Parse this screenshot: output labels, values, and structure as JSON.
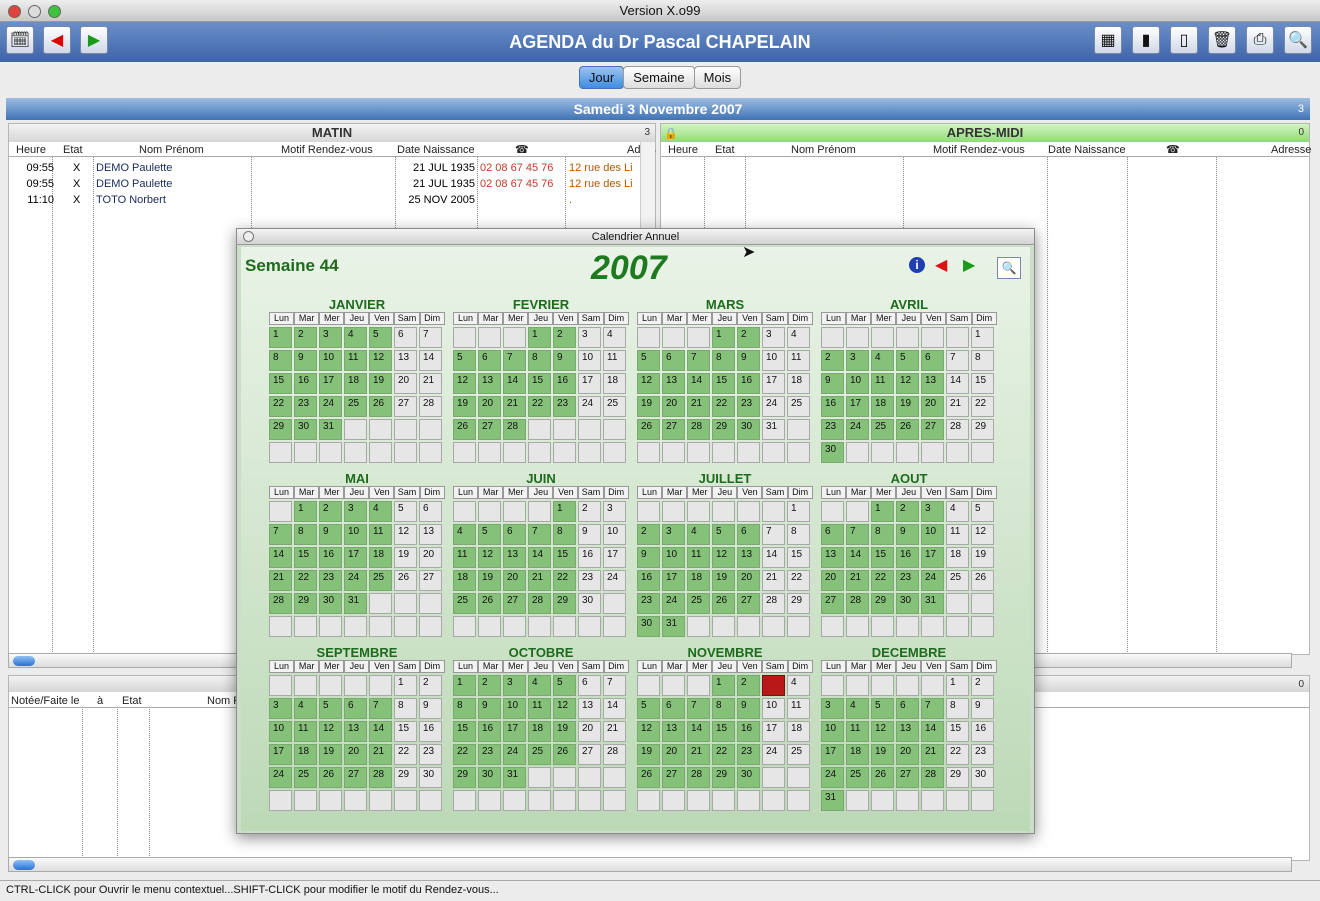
{
  "window": {
    "title": "Version X.o99"
  },
  "app": {
    "title": "AGENDA du Dr Pascal CHAPELAIN"
  },
  "tabs": [
    "Jour",
    "Semaine",
    "Mois"
  ],
  "date_header": {
    "label": "Samedi 3 Novembre 2007",
    "count": "3"
  },
  "matin": {
    "title": "MATIN",
    "count": "3",
    "columns": [
      "Heure",
      "Etat",
      "Nom Prénom",
      "Motif Rendez-vous",
      "Date Naissance",
      "☎",
      "Adres"
    ],
    "rows": [
      {
        "heure": "09:55",
        "etat": "X",
        "nom": "DEMO Paulette",
        "motif": "",
        "naissance": "21 JUL 1935",
        "tel": "02 08 67 45 76",
        "adresse": "12 rue des Li"
      },
      {
        "heure": "09:55",
        "etat": "X",
        "nom": "DEMO Paulette",
        "motif": "",
        "naissance": "21 JUL 1935",
        "tel": "02 08 67 45 76",
        "adresse": "12 rue des Li"
      },
      {
        "heure": "11:10",
        "etat": "X",
        "nom": "TOTO Norbert",
        "motif": "",
        "naissance": "25 NOV 2005",
        "tel": "",
        "adresse": "."
      }
    ]
  },
  "apresmidi": {
    "title": "APRES-MIDI",
    "count": "0",
    "columns": [
      "Heure",
      "Etat",
      "Nom Prénom",
      "Motif Rendez-vous",
      "Date Naissance",
      "☎",
      "Adresse"
    ]
  },
  "lower": {
    "count": "0",
    "columns": [
      "Notée/Faite le",
      "à",
      "Etat",
      "Nom P"
    ]
  },
  "status": "CTRL-CLICK pour Ouvrir le menu contextuel...SHIFT-CLICK pour modifier le motif du Rendez-vous...",
  "calendar": {
    "dialog_title": "Calendrier Annuel",
    "week_label": "Semaine 44",
    "year": "2007",
    "weekday_headers": [
      "Lun",
      "Mar",
      "Mer",
      "Jeu",
      "Ven",
      "Sam",
      "Dim"
    ],
    "selected": {
      "month": 10,
      "day": 3
    },
    "months": [
      {
        "name": "JANVIER",
        "offset": 0,
        "days": 31
      },
      {
        "name": "FEVRIER",
        "offset": 3,
        "days": 28
      },
      {
        "name": "MARS",
        "offset": 3,
        "days": 31
      },
      {
        "name": "AVRIL",
        "offset": 6,
        "days": 30
      },
      {
        "name": "MAI",
        "offset": 1,
        "days": 31
      },
      {
        "name": "JUIN",
        "offset": 4,
        "days": 30
      },
      {
        "name": "JUILLET",
        "offset": 6,
        "days": 31
      },
      {
        "name": "AOUT",
        "offset": 2,
        "days": 31
      },
      {
        "name": "SEPTEMBRE",
        "offset": 5,
        "days": 30
      },
      {
        "name": "OCTOBRE",
        "offset": 0,
        "days": 31
      },
      {
        "name": "NOVEMBRE",
        "offset": 3,
        "days": 30
      },
      {
        "name": "DECEMBRE",
        "offset": 5,
        "days": 31
      }
    ]
  }
}
